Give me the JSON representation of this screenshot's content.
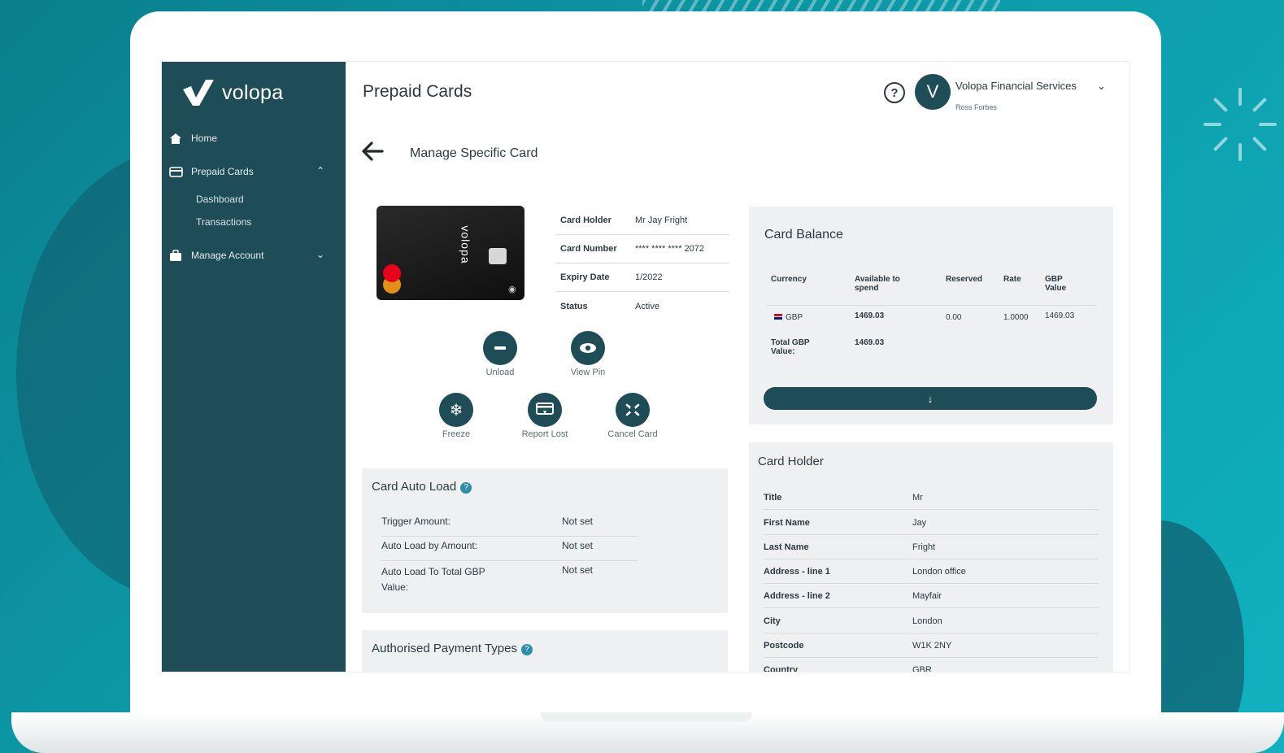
{
  "sidebar": {
    "logo_text": "volopa",
    "items": [
      {
        "label": "Home",
        "icon": "home-icon"
      },
      {
        "label": "Prepaid Cards",
        "icon": "cards-icon",
        "chevron": "⌃"
      },
      {
        "label": "Manage Account",
        "icon": "briefcase-icon",
        "chevron": "⌄"
      }
    ],
    "sub_items": [
      {
        "label": "Dashboard"
      },
      {
        "label": "Transactions"
      }
    ]
  },
  "header": {
    "title": "Prepaid Cards",
    "help_label": "?",
    "avatar_letter": "V",
    "org_name": "Volopa Financial Services",
    "org_chevron": "⌄",
    "user_name": "Ross Forbes"
  },
  "page": {
    "subtitle": "Manage Specific Card"
  },
  "card": {
    "brand": "volopa",
    "details": [
      {
        "label": "Card Holder",
        "value": "Mr Jay Fright"
      },
      {
        "label": "Card Number",
        "value": "**** **** **** 2072"
      },
      {
        "label": "Expiry Date",
        "value": "1/2022"
      },
      {
        "label": "Status",
        "value": "Active"
      }
    ]
  },
  "actions": [
    {
      "label": "Unload",
      "icon": "minus-icon"
    },
    {
      "label": "View Pin",
      "icon": "eye-icon"
    },
    {
      "label": "Freeze",
      "icon": "snowflake-icon"
    },
    {
      "label": "Report Lost",
      "icon": "report-icon"
    },
    {
      "label": "Cancel Card",
      "icon": "cancel-card-icon"
    }
  ],
  "auto_load": {
    "title": "Card Auto Load",
    "rows": [
      {
        "label": "Trigger Amount:",
        "value": "Not set"
      },
      {
        "label": "Auto Load by Amount:",
        "value": "Not set"
      },
      {
        "label": "Auto Load To Total GBP Value:",
        "value": "Not set"
      }
    ]
  },
  "payment_types": {
    "title": "Authorised Payment Types"
  },
  "balance": {
    "title": "Card Balance",
    "headers": [
      "Currency",
      "Available to spend",
      "Reserved",
      "Rate",
      "GBP Value"
    ],
    "rows": [
      {
        "currency": "GBP",
        "available": "1469.03",
        "reserved": "0.00",
        "rate": "1.0000",
        "gbp_value": "1469.03"
      }
    ],
    "total_label": "Total GBP Value:",
    "total_value": "1469.03",
    "button_icon": "↓"
  },
  "holder": {
    "title": "Card Holder",
    "rows": [
      {
        "label": "Title",
        "value": "Mr"
      },
      {
        "label": "First Name",
        "value": "Jay"
      },
      {
        "label": "Last Name",
        "value": "Fright"
      },
      {
        "label": "Address - line 1",
        "value": "London office"
      },
      {
        "label": "Address - line 2",
        "value": "Mayfair"
      },
      {
        "label": "City",
        "value": "London"
      },
      {
        "label": "Postcode",
        "value": "W1K 2NY"
      },
      {
        "label": "Country",
        "value": "GBR"
      }
    ]
  },
  "colors": {
    "primary": "#1e4c57",
    "background": "#0d9aa8",
    "panel": "#eef0f1",
    "info": "#2e8ea7"
  }
}
